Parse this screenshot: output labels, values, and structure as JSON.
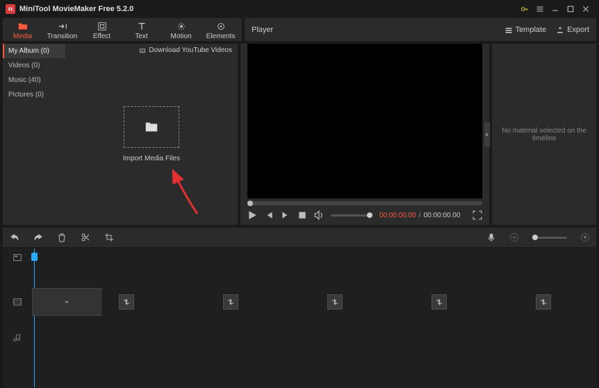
{
  "app": {
    "title": "MiniTool MovieMaker Free 5.2.0"
  },
  "tabs": {
    "media": "Media",
    "transition": "Transition",
    "effect": "Effect",
    "text": "Text",
    "motion": "Motion",
    "elements": "Elements"
  },
  "folders": {
    "my_album": "My Album (0)",
    "videos": "Videos (0)",
    "music": "Music (40)",
    "pictures": "Pictures (0)"
  },
  "download_link": "Download YouTube Videos",
  "import_label": "Import Media Files",
  "player": {
    "label": "Player",
    "template": "Template",
    "export": "Export",
    "current_time": "00:00:00.00",
    "separator": "/",
    "total_time": "00:00:00.00"
  },
  "right_panel": {
    "message": "No material selected on the timeline"
  }
}
